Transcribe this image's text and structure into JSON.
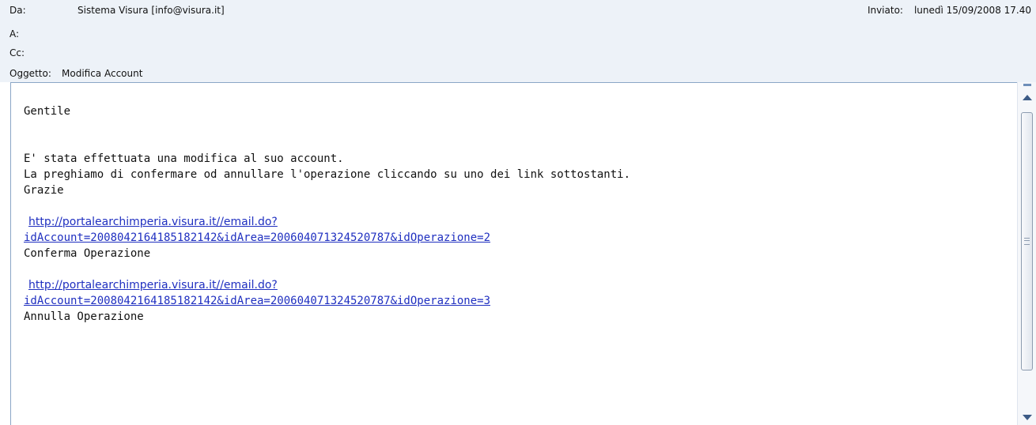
{
  "header": {
    "from_label": "Da:",
    "from_value": "Sistema Visura [info@visura.it]",
    "to_label": "A:",
    "to_value": "",
    "cc_label": "Cc:",
    "cc_value": "",
    "subject_label": "Oggetto:",
    "subject_value": "Modifica Account",
    "sent_label": "Inviato:",
    "sent_value": "lunedì 15/09/2008 17.40"
  },
  "body": {
    "greeting": "Gentile",
    "line1": "E' stata effettuata una modifica al suo account.",
    "line2": "La preghiamo di confermare od annullare l'operazione cliccando su uno dei link sottostanti.",
    "line3": "Grazie",
    "link1_part1": "http://portalearchimperia.visura.it//email.do?",
    "link1_part2": "idAccount=200804216418518​2142&idArea=20060407132452078​7&idOperazione=2",
    "link1_caption": "Conferma Operazione",
    "link2_part1": "http://portalearchimperia.visura.it//email.do?",
    "link2_part2": "idAccount=200804216418518​2142&idArea=20060407132452078​7&idOperazione=3",
    "link2_caption": "Annulla Operazione"
  },
  "colors": {
    "header_bg": "#edf2f8",
    "link": "#1f2fc0",
    "frame_border": "#8aa6c6"
  }
}
